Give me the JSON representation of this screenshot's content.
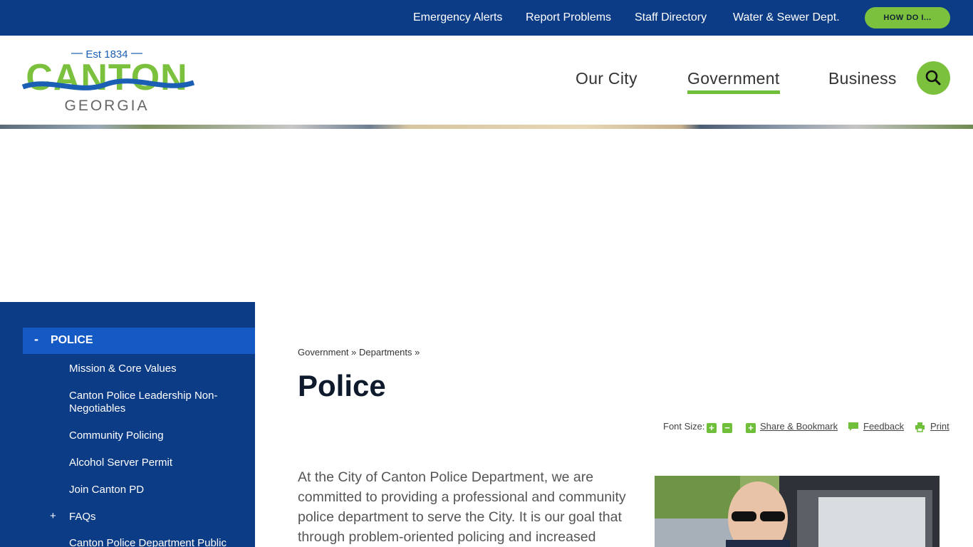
{
  "topbar": {
    "links": [
      "Emergency Alerts",
      "Report Problems",
      "Staff Directory",
      "Water & Sewer Dept."
    ],
    "how_do_i": "HOW DO I..."
  },
  "logo": {
    "est": "Est 1834",
    "name": "CANTON",
    "state": "GEORGIA"
  },
  "nav": {
    "items": [
      "Our City",
      "Government",
      "Business"
    ],
    "active": "Government"
  },
  "sidebar": {
    "title": "POLICE",
    "items": [
      "Mission & Core Values",
      "Canton Police Leadership Non-Negotiables",
      "Community Policing",
      "Alcohol Server Permit",
      "Join Canton PD",
      "FAQs",
      "Canton Police Department Public"
    ]
  },
  "breadcrumb": {
    "items": [
      "Government",
      "Departments"
    ],
    "separator": "»"
  },
  "page": {
    "title": "Police",
    "font_size_label": "Font Size:",
    "share_label": "Share & Bookmark",
    "feedback_label": "Feedback",
    "print_label": "Print",
    "intro": "At the City of Canton Police Department, we are committed to providing a professional and community police department to serve the City. It is our goal that through problem-oriented policing and increased"
  },
  "colors": {
    "primary_blue": "#0d3c87",
    "active_blue": "#1559c4",
    "accent_green": "#7cc13e"
  }
}
